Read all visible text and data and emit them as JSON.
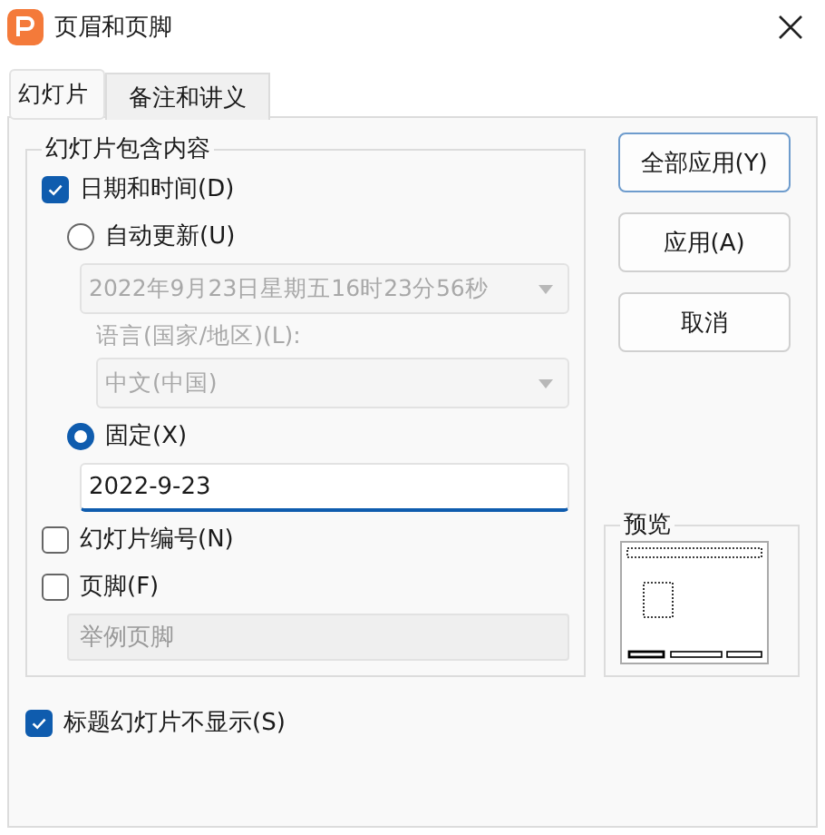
{
  "window": {
    "title": "页眉和页脚"
  },
  "tabs": [
    {
      "label": "幻灯片",
      "selected": true
    },
    {
      "label": "备注和讲义",
      "selected": false
    }
  ],
  "slide_content": {
    "title": "幻灯片包含内容",
    "date_time": {
      "label": "日期和时间(D)",
      "checked": true
    },
    "auto_update": {
      "label": "自动更新(U)",
      "selected": false
    },
    "date_format": {
      "value": "2022年9月23日星期五16时23分56秒",
      "disabled": true
    },
    "language_label": {
      "text": "语言(国家/地区)(L):",
      "disabled": true
    },
    "language": {
      "value": "中文(中国)",
      "disabled": true
    },
    "fixed": {
      "label": "固定(X)",
      "selected": true
    },
    "fixed_date": {
      "value": "2022-9-23"
    },
    "slide_number": {
      "label": "幻灯片编号(N)",
      "checked": false
    },
    "footer": {
      "label": "页脚(F)",
      "checked": false
    },
    "footer_text": {
      "placeholder": "举例页脚",
      "disabled": true
    }
  },
  "hide_on_title": {
    "label": "标题幻灯片不显示(S)",
    "checked": true
  },
  "buttons": [
    {
      "label": "全部应用(Y)",
      "default": true
    },
    {
      "label": "应用(A)",
      "default": false
    },
    {
      "label": "取消",
      "default": false
    }
  ],
  "preview": {
    "title": "预览"
  }
}
